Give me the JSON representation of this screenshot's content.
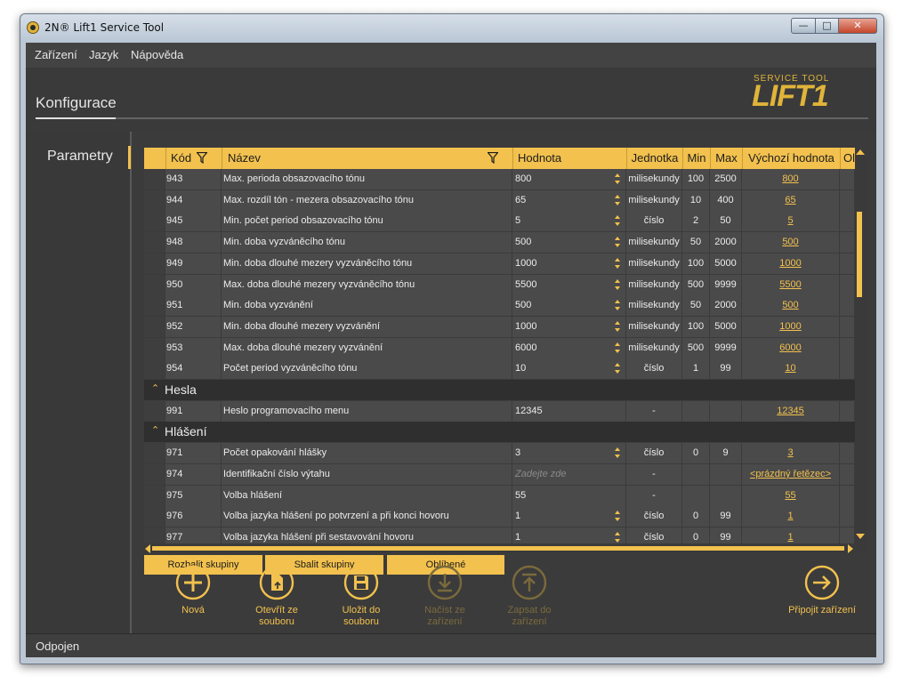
{
  "window": {
    "title": "2N® Lift1 Service Tool",
    "min": "—",
    "max": "□",
    "close": "✕"
  },
  "menu": [
    "Zařízení",
    "Jazyk",
    "Nápověda"
  ],
  "page_title": "Konfigurace",
  "logo": {
    "sub": "SERVICE TOOL",
    "main": "LIFT1"
  },
  "sidebar": {
    "items": [
      "Parametry"
    ]
  },
  "table": {
    "columns": [
      "Kód",
      "Název",
      "Hodnota",
      "Jednotka",
      "Min",
      "Max",
      "Výchozí hodnota",
      "Ol"
    ],
    "rows": [
      {
        "kod": "943",
        "nazev": "Max. perioda obsazovacího tónu",
        "hodnota": "800",
        "jednotka": "milisekundy",
        "min": "100",
        "max": "2500",
        "vychozi": "800"
      },
      {
        "kod": "944",
        "nazev": "Max. rozdíl tón - mezera obsazovacího tónu",
        "hodnota": "65",
        "jednotka": "milisekundy",
        "min": "10",
        "max": "400",
        "vychozi": "65"
      },
      {
        "kod": "945",
        "nazev": "Min. počet period obsazovacího tónu",
        "hodnota": "5",
        "jednotka": "číslo",
        "min": "2",
        "max": "50",
        "vychozi": "5"
      },
      {
        "kod": "948",
        "nazev": "Min. doba vyzváněcího tónu",
        "hodnota": "500",
        "jednotka": "milisekundy",
        "min": "50",
        "max": "2000",
        "vychozi": "500"
      },
      {
        "kod": "949",
        "nazev": "Min. doba dlouhé mezery vyzváněcího tónu",
        "hodnota": "1000",
        "jednotka": "milisekundy",
        "min": "100",
        "max": "5000",
        "vychozi": "1000"
      },
      {
        "kod": "950",
        "nazev": "Max. doba dlouhé mezery vyzváněcího tónu",
        "hodnota": "5500",
        "jednotka": "milisekundy",
        "min": "500",
        "max": "9999",
        "vychozi": "5500"
      },
      {
        "kod": "951",
        "nazev": "Min. doba vyzvánění",
        "hodnota": "500",
        "jednotka": "milisekundy",
        "min": "50",
        "max": "2000",
        "vychozi": "500"
      },
      {
        "kod": "952",
        "nazev": "Min. doba dlouhé mezery vyzvánění",
        "hodnota": "1000",
        "jednotka": "milisekundy",
        "min": "100",
        "max": "5000",
        "vychozi": "1000"
      },
      {
        "kod": "953",
        "nazev": "Max. doba dlouhé mezery vyzvánění",
        "hodnota": "6000",
        "jednotka": "milisekundy",
        "min": "500",
        "max": "9999",
        "vychozi": "6000"
      },
      {
        "kod": "954",
        "nazev": "Počet period vyzváněcího tónu",
        "hodnota": "10",
        "jednotka": "číslo",
        "min": "1",
        "max": "99",
        "vychozi": "10"
      }
    ],
    "groups": [
      {
        "label": "Hesla",
        "rows": [
          {
            "kod": "991",
            "nazev": "Heslo programovacího menu",
            "hodnota": "12345",
            "jednotka": "-",
            "min": "",
            "max": "",
            "vychozi": "12345"
          }
        ]
      },
      {
        "label": "Hlášení",
        "rows": [
          {
            "kod": "971",
            "nazev": "Počet opakování hlášky",
            "hodnota": "3",
            "jednotka": "číslo",
            "min": "0",
            "max": "9",
            "vychozi": "3"
          },
          {
            "kod": "974",
            "nazev": "Identifikační číslo výtahu",
            "hodnota": "",
            "placeholder": "Zadejte zde",
            "jednotka": "-",
            "min": "",
            "max": "",
            "vychozi": "<prázdný řetězec>"
          },
          {
            "kod": "975",
            "nazev": "Volba hlášení",
            "hodnota": "55",
            "jednotka": "-",
            "min": "",
            "max": "",
            "vychozi": "55"
          },
          {
            "kod": "976",
            "nazev": "Volba jazyka hlášení po potvrzení a při konci hovoru",
            "hodnota": "1",
            "jednotka": "číslo",
            "min": "0",
            "max": "99",
            "vychozi": "1"
          },
          {
            "kod": "977",
            "nazev": "Volba jazyka hlášení při sestavování hovoru",
            "hodnota": "1",
            "jednotka": "číslo",
            "min": "0",
            "max": "99",
            "vychozi": "1"
          }
        ]
      }
    ]
  },
  "toolbar": {
    "expand": "Rozbalit skupiny",
    "collapse": "Sbalit skupiny",
    "favorites": "Oblíbené"
  },
  "actions": [
    {
      "name": "new",
      "label": "Nová",
      "icon": "plus-icon",
      "enabled": true
    },
    {
      "name": "open",
      "label": "Otevřít ze\nsouboru",
      "icon": "open-file-icon",
      "enabled": true
    },
    {
      "name": "save",
      "label": "Uložit do\nsouboru",
      "icon": "floppy-icon",
      "enabled": true
    },
    {
      "name": "load",
      "label": "Načíst ze\nzařízení",
      "icon": "download-icon",
      "enabled": false
    },
    {
      "name": "write",
      "label": "Zapsat do\nzařízení",
      "icon": "upload-icon",
      "enabled": false
    },
    {
      "name": "connect",
      "label": "Připojit zařízení",
      "icon": "arrow-right-icon",
      "enabled": true
    }
  ],
  "status": "Odpojen",
  "colors": {
    "accent": "#f2c14e",
    "background": "#3b3b3b",
    "row": "#4a4a4a"
  }
}
